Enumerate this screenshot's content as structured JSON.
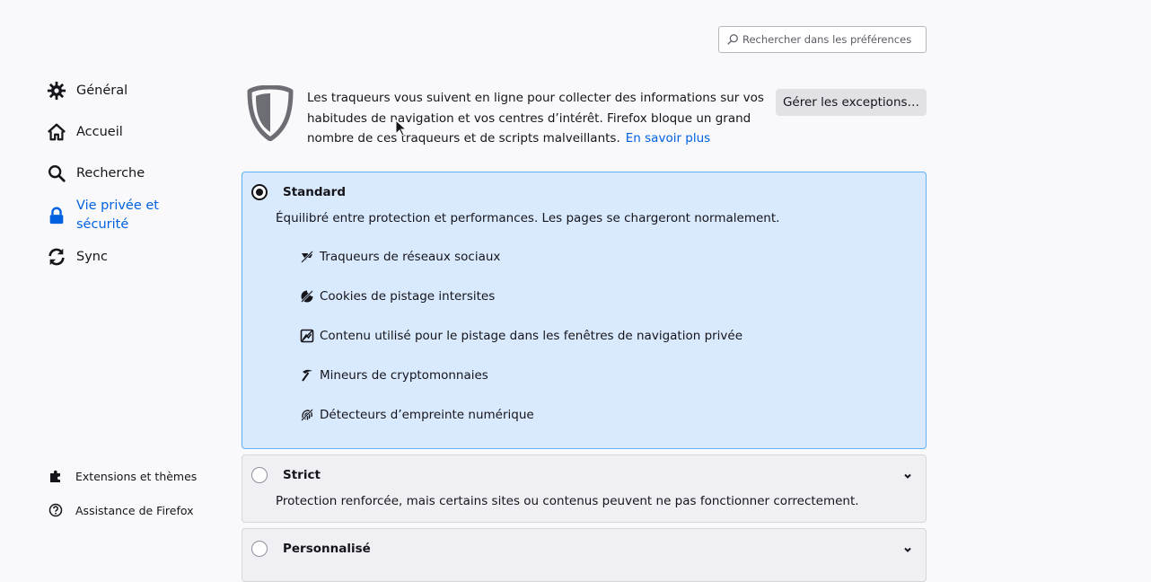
{
  "search": {
    "placeholder": "Rechercher dans les préférences",
    "icon": "search-icon"
  },
  "sidebar": {
    "items": [
      {
        "label": "Général",
        "icon": "gear-icon"
      },
      {
        "label": "Accueil",
        "icon": "home-icon"
      },
      {
        "label": "Recherche",
        "icon": "search-icon"
      },
      {
        "label": "Vie privée et sécurité",
        "label_line1": "Vie privée et",
        "label_line2": "sécurité",
        "icon": "lock-icon",
        "active": true
      },
      {
        "label": "Sync",
        "icon": "sync-icon"
      }
    ],
    "footer": [
      {
        "label": "Extensions et thèmes",
        "icon": "puzzle-icon"
      },
      {
        "label": "Assistance de Firefox",
        "icon": "help-icon"
      }
    ]
  },
  "intro": {
    "text": "Les traqueurs vous suivent en ligne pour collecter des informations sur vos habitudes de navigation et vos centres d’intérêt. Firefox bloque un grand nombre de ces traqueurs et de scripts malveillants.",
    "learn_more": "En savoir plus",
    "manage_exceptions": "Gérer les exceptions…"
  },
  "options": {
    "standard": {
      "title": "Standard",
      "selected": true,
      "description": "Équilibré entre protection et performances. Les pages se chargeront normalement.",
      "features": [
        {
          "label": "Traqueurs de réseaux sociaux",
          "icon": "social-tracker-icon"
        },
        {
          "label": "Cookies de pistage intersites",
          "icon": "cookie-icon"
        },
        {
          "label": "Contenu utilisé pour le pistage dans les fenêtres de navigation privée",
          "icon": "tracking-content-icon"
        },
        {
          "label": "Mineurs de cryptomonnaies",
          "icon": "cryptominer-icon"
        },
        {
          "label": "Détecteurs d’empreinte numérique",
          "icon": "fingerprinter-icon"
        }
      ]
    },
    "strict": {
      "title": "Strict",
      "selected": false,
      "description": "Protection renforcée, mais certains sites ou contenus peuvent ne pas fonctionner correctement."
    },
    "custom": {
      "title": "Personnalisé",
      "selected": false
    }
  },
  "colors": {
    "accent": "#0061e0",
    "selected_card_bg": "#d9eafe",
    "selected_card_border": "#60b0f3",
    "collapsed_card_bg": "#f0f0f4"
  }
}
